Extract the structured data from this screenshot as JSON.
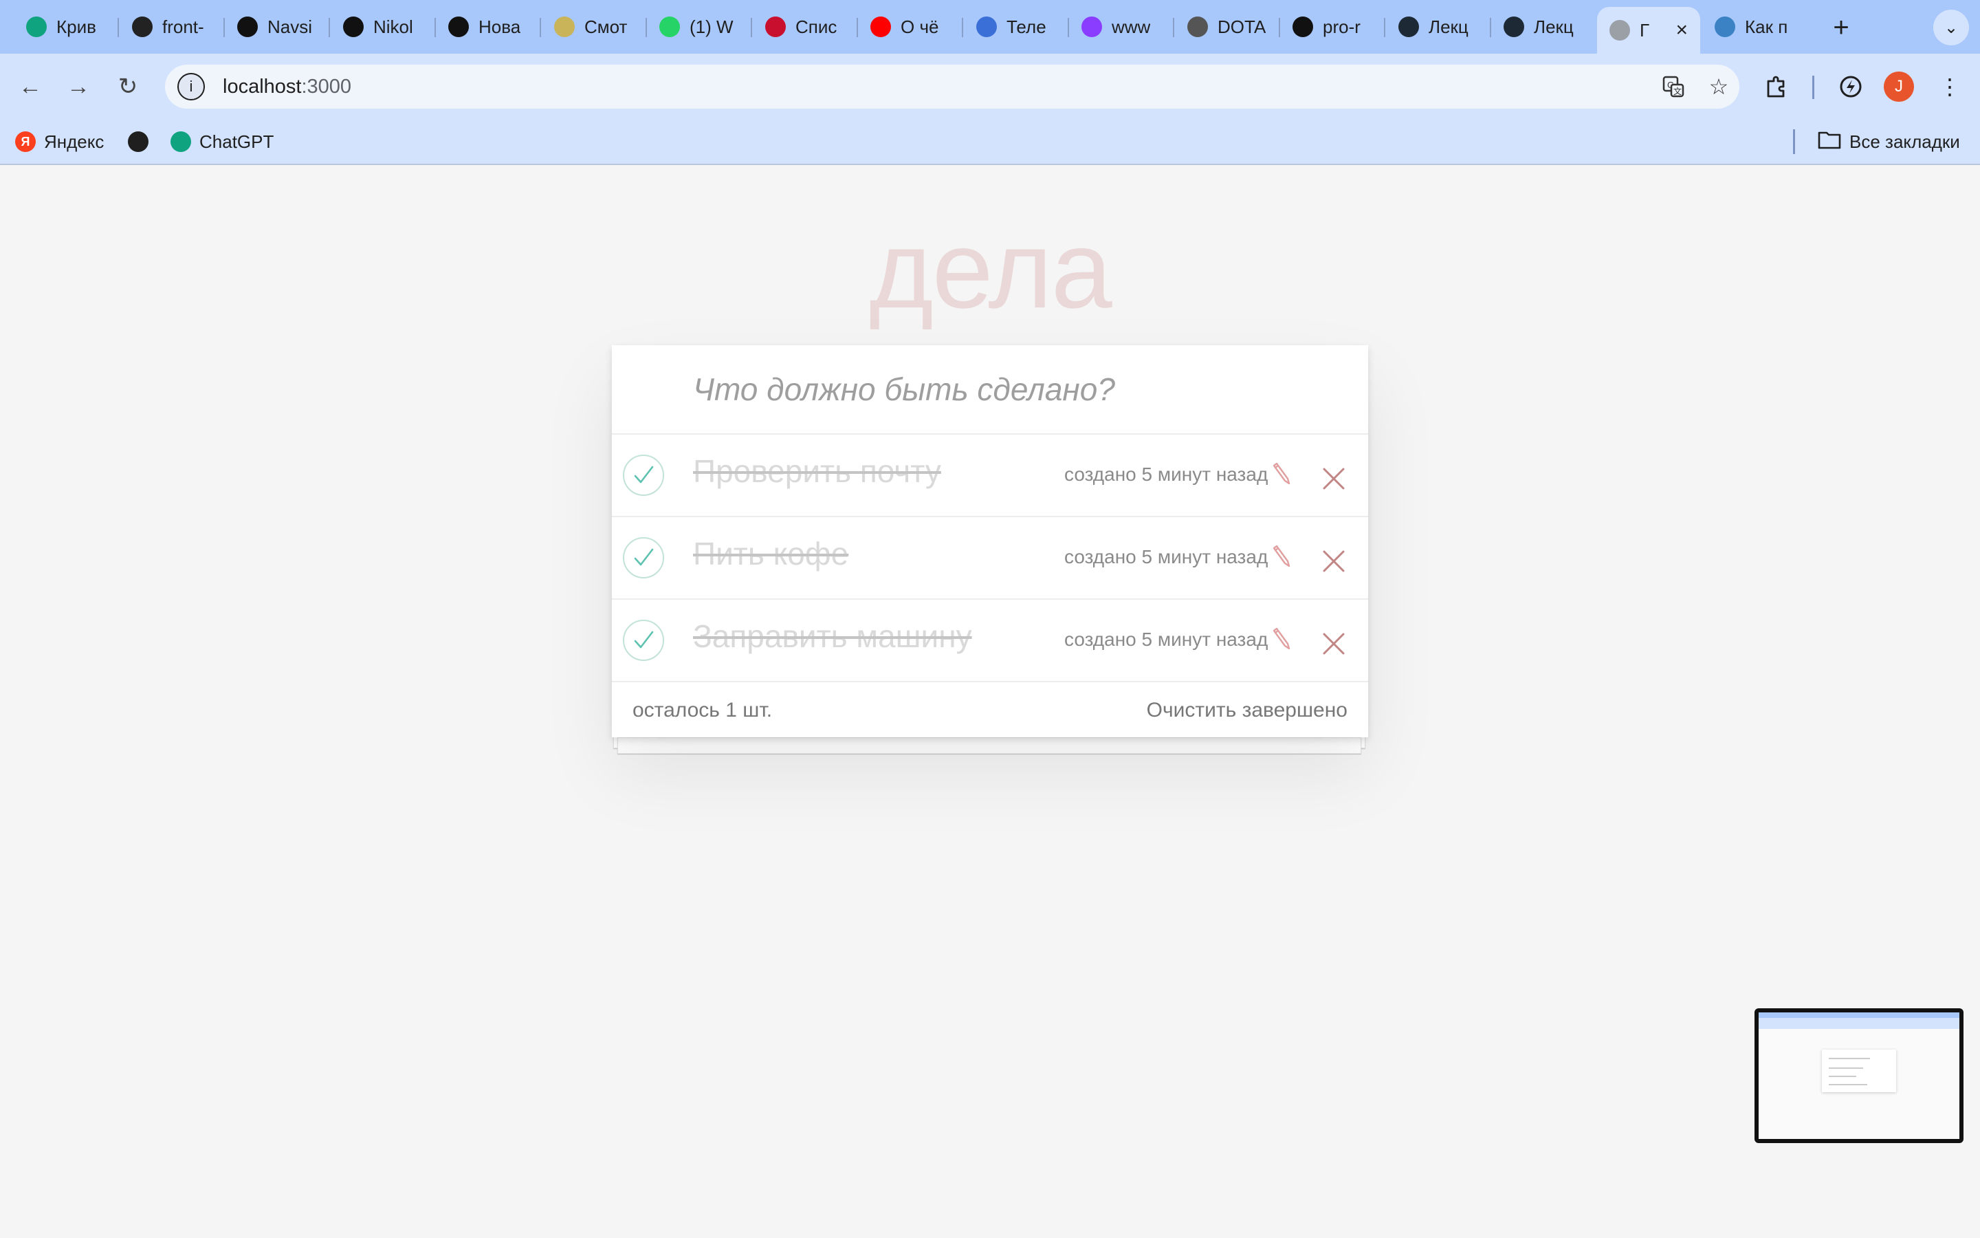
{
  "browser": {
    "tabs": [
      {
        "title": "Крив",
        "icon": "chatgpt-icon",
        "color": "#10a37f"
      },
      {
        "title": "front-",
        "icon": "power-icon",
        "color": "#222222"
      },
      {
        "title": "Navsi",
        "icon": "github-icon",
        "color": "#111111"
      },
      {
        "title": "Nikol",
        "icon": "github-icon",
        "color": "#111111"
      },
      {
        "title": "Нова",
        "icon": "r-logo-icon",
        "color": "#111111"
      },
      {
        "title": "Смот",
        "icon": "flower-icon",
        "color": "#c9b45a"
      },
      {
        "title": "(1) W",
        "icon": "whatsapp-icon",
        "color": "#25d366"
      },
      {
        "title": "Спис",
        "icon": "kfc-icon",
        "color": "#c8102e"
      },
      {
        "title": "О чё",
        "icon": "youtube-icon",
        "color": "#ff0000"
      },
      {
        "title": "Теле",
        "icon": "chat-icon",
        "color": "#3b6fd8"
      },
      {
        "title": "www",
        "icon": "u-logo-icon",
        "color": "#8b3dff"
      },
      {
        "title": "DOTA",
        "icon": "dota-icon",
        "color": "#555555"
      },
      {
        "title": "pro-r",
        "icon": "github-icon",
        "color": "#111111"
      },
      {
        "title": "Лекц",
        "icon": "lecture-icon",
        "color": "#1d2a36"
      },
      {
        "title": "Лекц",
        "icon": "lecture-icon",
        "color": "#1d2a36"
      },
      {
        "title": "Г",
        "icon": "globe-icon",
        "color": "#9aa0a6",
        "active": true
      },
      {
        "title": "Как п",
        "icon": "react-icon",
        "color": "#3b82c4"
      }
    ],
    "url_host": "localhost",
    "url_port": ":3000",
    "bookmarks": [
      {
        "label": "Яндекс",
        "icon": "yandex-icon",
        "color": "#fc3f1d"
      },
      {
        "label": "",
        "icon": "globe-icon",
        "color": "#1f1f1f"
      },
      {
        "label": "ChatGPT",
        "icon": "chatgpt-icon",
        "color": "#10a37f"
      }
    ],
    "all_bookmarks": "Все закладки",
    "avatar_letter": "J"
  },
  "app": {
    "title": "дела",
    "new_todo_placeholder": "Что должно быть сделано?",
    "todos": [
      {
        "label": "Проверить почту",
        "created": "создано 5 минут назад",
        "completed": true
      },
      {
        "label": "Пить кофе",
        "created": "создано 5 минут назад",
        "completed": true
      },
      {
        "label": "Заправить машину",
        "created": "создано 5 минут назад",
        "completed": true
      }
    ],
    "footer": {
      "count": "осталось 1 шт.",
      "clear_completed": "Очистить завершено"
    },
    "colors": {
      "title": "rgba(175,47,47,0.15)",
      "check": "#5dc2af",
      "destroy": "#c18585",
      "edit": "#e0a0a0"
    }
  }
}
